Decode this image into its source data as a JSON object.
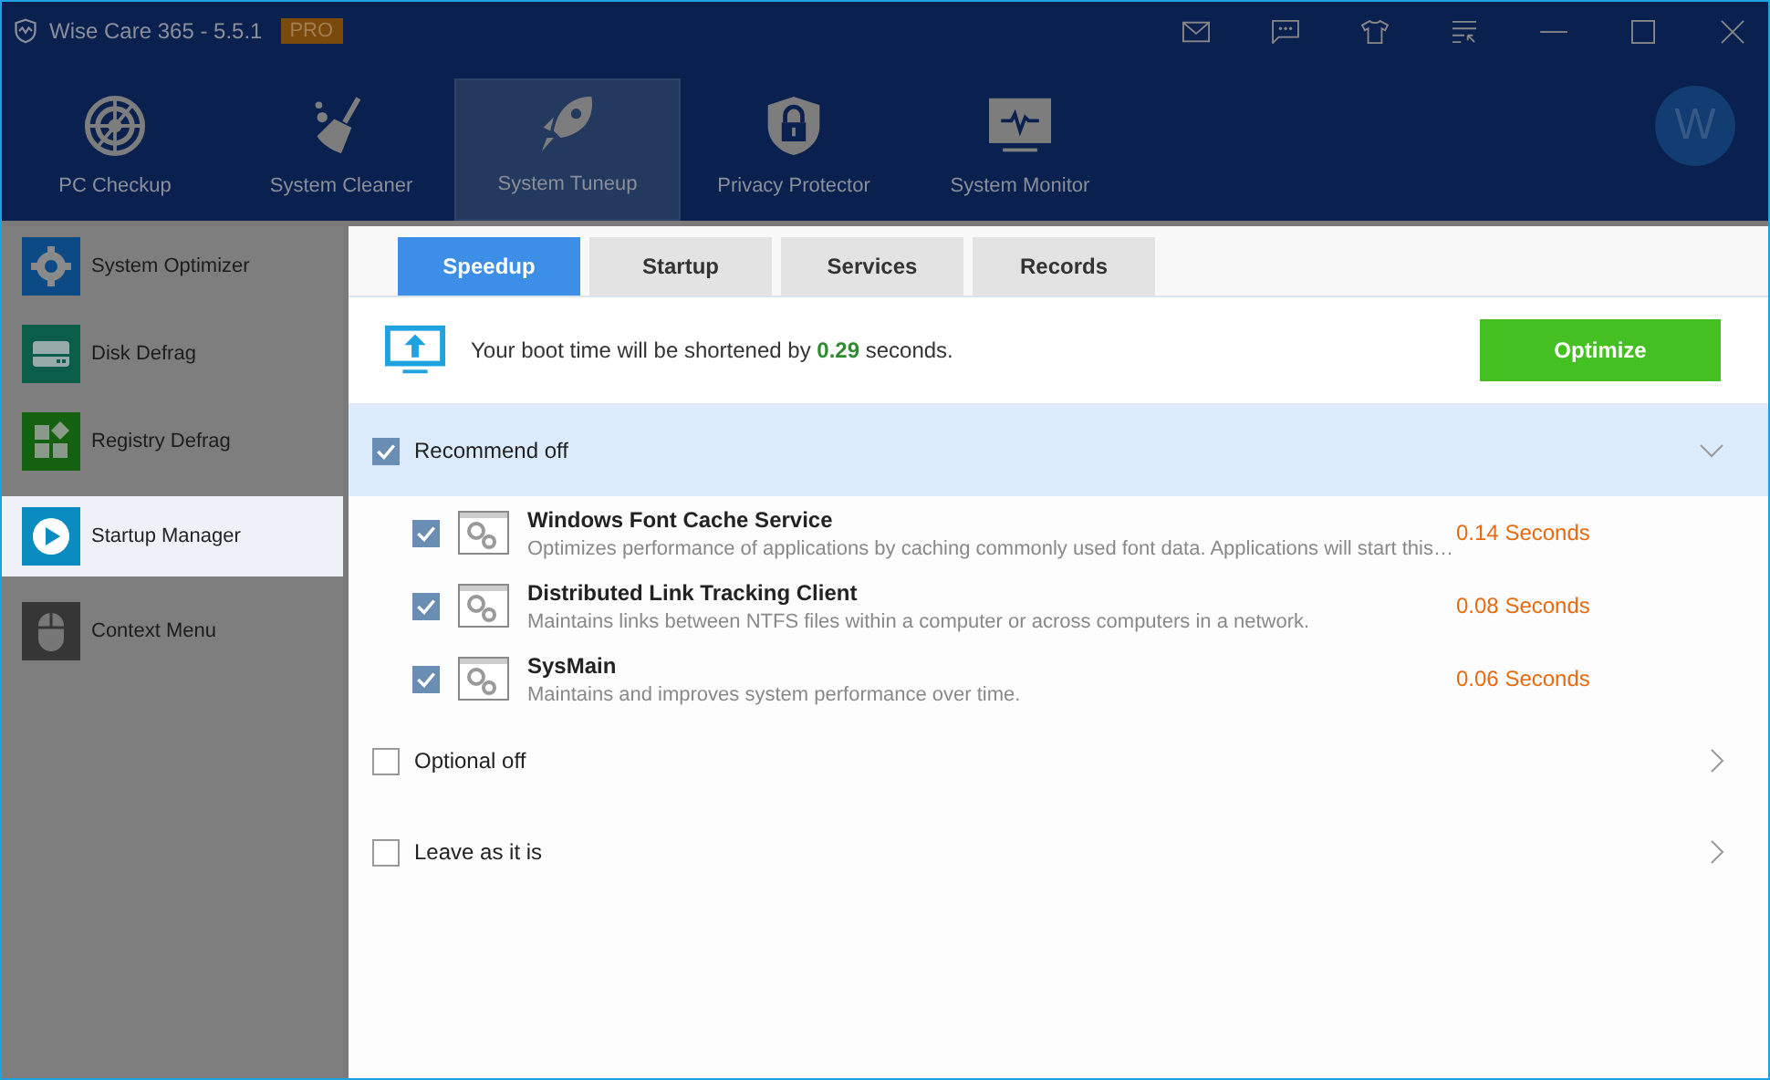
{
  "window": {
    "title": "Wise Care 365 - 5.5.1",
    "badge": "PRO"
  },
  "nav": [
    {
      "label": "PC Checkup",
      "selected": false
    },
    {
      "label": "System Cleaner",
      "selected": false
    },
    {
      "label": "System Tuneup",
      "selected": true
    },
    {
      "label": "Privacy Protector",
      "selected": false
    },
    {
      "label": "System Monitor",
      "selected": false
    }
  ],
  "avatar": "W",
  "sidebar": [
    {
      "label": "System Optimizer",
      "selected": false,
      "color": "#0c4a86"
    },
    {
      "label": "Disk Defrag",
      "selected": false,
      "color": "#0b5e4a"
    },
    {
      "label": "Registry Defrag",
      "selected": false,
      "color": "#14620f"
    },
    {
      "label": "Startup Manager",
      "selected": true,
      "color": "#0a8cc0"
    },
    {
      "label": "Context Menu",
      "selected": false,
      "color": "#363636"
    }
  ],
  "tabs": [
    {
      "label": "Speedup",
      "selected": true
    },
    {
      "label": "Startup",
      "selected": false
    },
    {
      "label": "Services",
      "selected": false
    },
    {
      "label": "Records",
      "selected": false
    }
  ],
  "banner": {
    "text": "Your boot time will be shortened by **0.29** seconds.",
    "button": "Optimize"
  },
  "groups": [
    {
      "label": "Recommend off",
      "checked": true,
      "expanded": true,
      "items": [
        {
          "name": "Windows Font Cache Service",
          "description": "Optimizes performance of applications by caching commonly used font data. Applications will start this…",
          "time": "0.14 Seconds",
          "checked": true
        },
        {
          "name": "Distributed Link Tracking Client",
          "description": "Maintains links between NTFS files within a computer or across computers in a network.",
          "time": "0.08 Seconds",
          "checked": true
        },
        {
          "name": "SysMain",
          "description": "Maintains and improves system performance over time.",
          "time": "0.06 Seconds",
          "checked": true
        }
      ]
    },
    {
      "label": "Optional off",
      "checked": false,
      "expanded": false
    },
    {
      "label": "Leave as it is",
      "checked": false,
      "expanded": false
    }
  ]
}
